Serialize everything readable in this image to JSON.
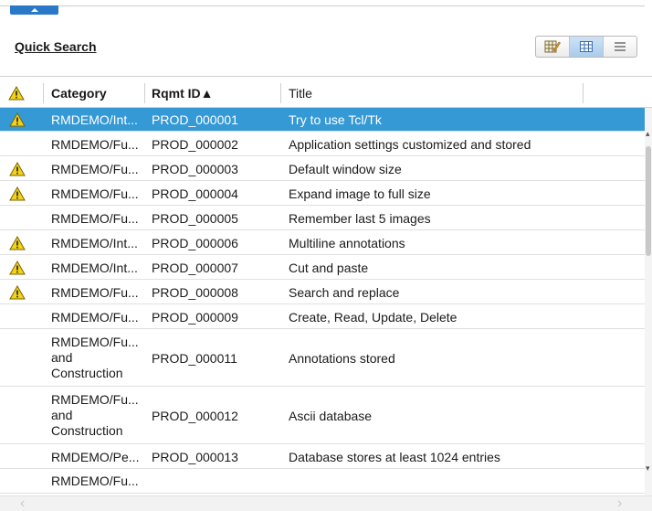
{
  "toolbar": {
    "quick_search_label": "Quick Search"
  },
  "view_switch": {
    "modes": [
      "edit-view-icon",
      "grid-view-icon",
      "list-view-icon"
    ],
    "active": "grid-view-icon"
  },
  "grid": {
    "columns": {
      "warning": "warning-icon",
      "category": "Category",
      "rqmt_id": "Rqmt ID▲",
      "title": "Title"
    },
    "rows": [
      {
        "warn": true,
        "category": "RMDEMO/Int...",
        "rqmt_id": "PROD_000001",
        "title": "Try to use Tcl/Tk",
        "selected": true
      },
      {
        "warn": false,
        "category": "RMDEMO/Fu...",
        "rqmt_id": "PROD_000002",
        "title": "Application settings customized and stored"
      },
      {
        "warn": true,
        "category": "RMDEMO/Fu...",
        "rqmt_id": "PROD_000003",
        "title": "Default window size"
      },
      {
        "warn": true,
        "category": "RMDEMO/Fu...",
        "rqmt_id": "PROD_000004",
        "title": "Expand image to full size"
      },
      {
        "warn": false,
        "category": "RMDEMO/Fu...",
        "rqmt_id": "PROD_000005",
        "title": "Remember last 5 images"
      },
      {
        "warn": true,
        "category": "RMDEMO/Int...",
        "rqmt_id": "PROD_000006",
        "title": "Multiline annotations"
      },
      {
        "warn": true,
        "category": "RMDEMO/Int...",
        "rqmt_id": "PROD_000007",
        "title": "Cut and paste"
      },
      {
        "warn": true,
        "category": "RMDEMO/Fu...",
        "rqmt_id": "PROD_000008",
        "title": "Search and replace"
      },
      {
        "warn": false,
        "category": "RMDEMO/Fu...",
        "rqmt_id": "PROD_000009",
        "title": "Create, Read, Update, Delete"
      },
      {
        "warn": false,
        "category": [
          "RMDEMO/Fu...",
          "and",
          "Construction"
        ],
        "rqmt_id": "PROD_000011",
        "title": "Annotations stored"
      },
      {
        "warn": false,
        "category": [
          "RMDEMO/Fu...",
          "and",
          "Construction"
        ],
        "rqmt_id": "PROD_000012",
        "title": "Ascii database"
      },
      {
        "warn": false,
        "category": "RMDEMO/Pe...",
        "rqmt_id": "PROD_000013",
        "title": "Database stores at least 1024 entries"
      },
      {
        "warn": false,
        "category": [
          "RMDEMO/Fu..."
        ],
        "rqmt_id": "",
        "title": ""
      }
    ]
  },
  "colors": {
    "selected_row": "#3499d5",
    "accent_tab": "#2a78c8",
    "warning_fill": "#f3d21b"
  }
}
